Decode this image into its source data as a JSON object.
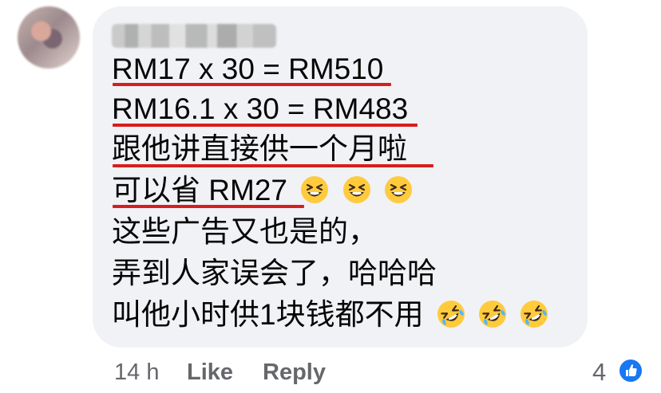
{
  "comment": {
    "lines": [
      "RM17 x 30 = RM510",
      "RM16.1 x 30 = RM483",
      "跟他讲直接供一个月啦",
      "可以省 RM27",
      "这些广告又也是的，",
      "弄到人家误会了，哈哈哈",
      "叫他小时供1块钱都不用"
    ],
    "line4_emoji": [
      "grinning-squinting-face",
      "grinning-squinting-face",
      "grinning-squinting-face"
    ],
    "line7_emoji": [
      "rolling-on-floor-laughing-face",
      "rolling-on-floor-laughing-face",
      "rolling-on-floor-laughing-face"
    ],
    "underline_color": "#d71e1e"
  },
  "footer": {
    "time": "14 h",
    "like_label": "Like",
    "reply_label": "Reply",
    "reaction_count": "4",
    "reaction_icon": "thumbs-up-icon"
  },
  "colors": {
    "bubble": "#f0f2f5",
    "text": "#050505",
    "secondary_text": "#65676b",
    "reaction_blue": "#1877f2"
  }
}
